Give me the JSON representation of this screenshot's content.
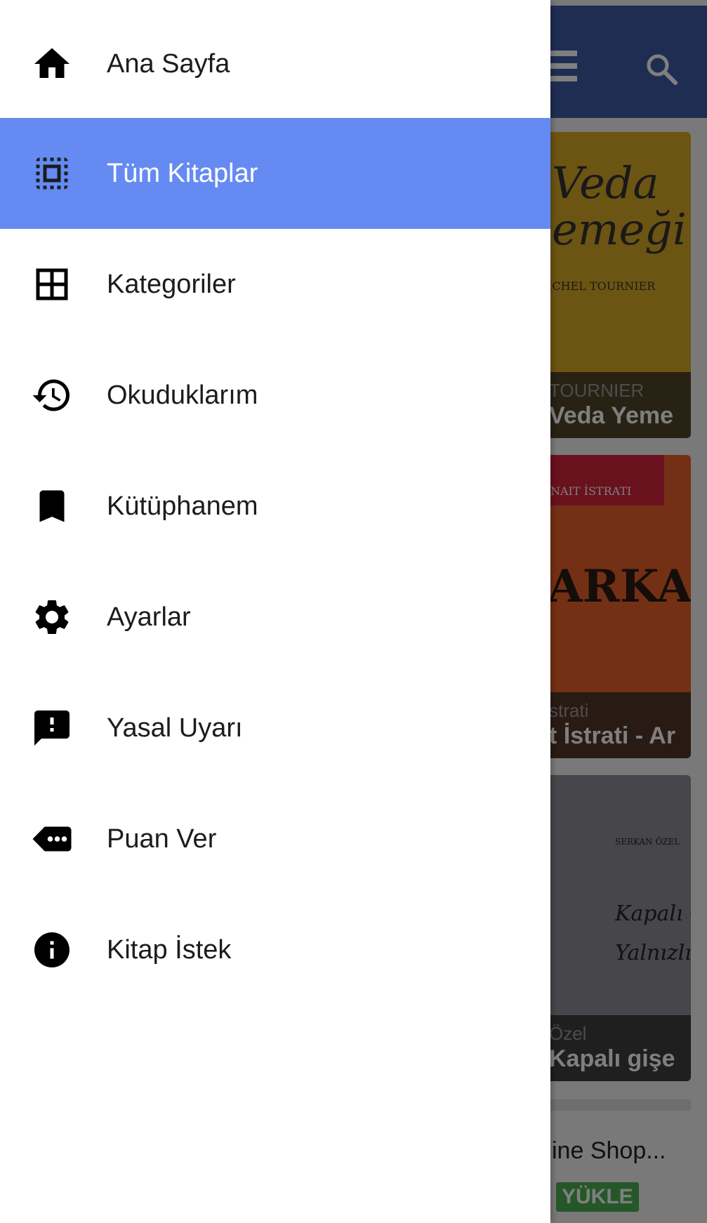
{
  "drawer": {
    "items": [
      {
        "label": "Ana Sayfa",
        "icon": "home-icon"
      },
      {
        "label": "Tüm Kitaplar",
        "icon": "select-all-icon",
        "active": true
      },
      {
        "label": "Kategoriler",
        "icon": "grid-icon"
      },
      {
        "label": "Okuduklarım",
        "icon": "history-icon"
      },
      {
        "label": "Kütüphanem",
        "icon": "bookmark-icon"
      },
      {
        "label": "Ayarlar",
        "icon": "gear-icon"
      },
      {
        "label": "Yasal Uyarı",
        "icon": "feedback-icon"
      },
      {
        "label": "Puan Ver",
        "icon": "rate-label-icon"
      },
      {
        "label": "Kitap İstek",
        "icon": "info-icon"
      }
    ],
    "active_color": "#658bf2"
  },
  "background": {
    "appbar_color": "#3f5aa6",
    "books": [
      {
        "author": "TOURNIER",
        "title": "Veda Yeme",
        "cover_text": "Veda\nemeği",
        "cover_sub": "ICHEL TOURNIER"
      },
      {
        "author": "strati",
        "title": "t İstrati - Ar",
        "cover_text": "ARKADAŞ",
        "cover_sub": "NAIT İSTRATI"
      },
      {
        "author": "Özel",
        "title": "Kapalı gişe",
        "cover_text": "Kapalı Gişe\nYalnızlık",
        "cover_sub": "SERKAN ÖZEL"
      }
    ],
    "shop_text": "ine Shop...",
    "download_label": "YÜKLE"
  }
}
